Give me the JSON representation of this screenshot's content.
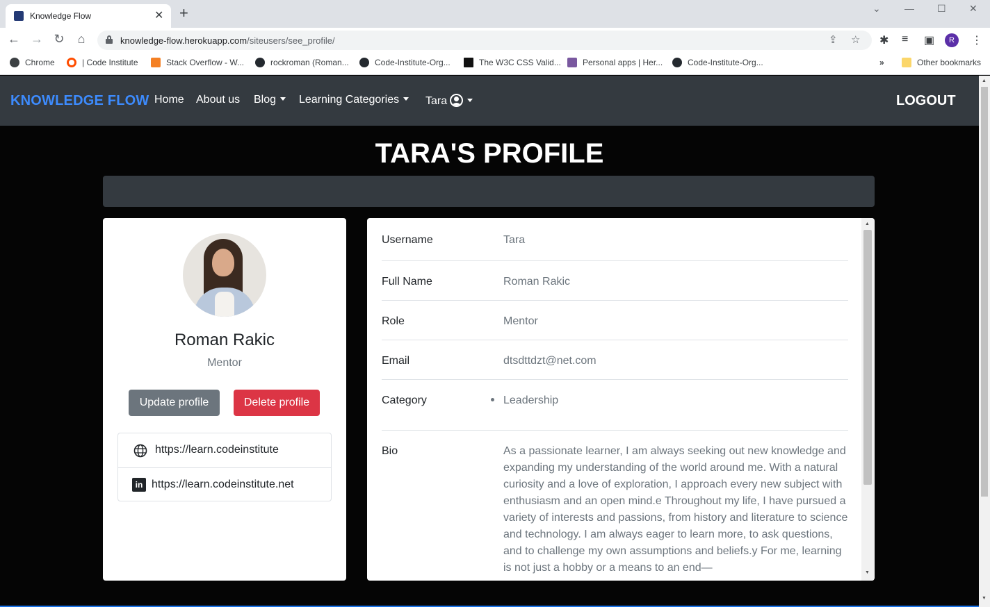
{
  "browser": {
    "tab_title": "Knowledge Flow",
    "url_host": "knowledge-flow.herokuapp.com",
    "url_path": "/siteusers/see_profile/",
    "profile_initial": "R",
    "bookmarks": [
      {
        "label": "Chrome",
        "color": "#3c4043"
      },
      {
        "label": "| Code Institute",
        "color": "#ff4d00"
      },
      {
        "label": "Stack Overflow - W...",
        "color": "#f48024"
      },
      {
        "label": "rockroman (Roman...",
        "color": "#24292f"
      },
      {
        "label": "Code-Institute-Org...",
        "color": "#24292f"
      },
      {
        "label": "The W3C CSS Valid...",
        "color": "#111111"
      },
      {
        "label": "Personal apps | Her...",
        "color": "#79589f"
      },
      {
        "label": "Code-Institute-Org...",
        "color": "#24292f"
      }
    ],
    "more_bookmarks": "»",
    "other_bookmarks": "Other bookmarks"
  },
  "navbar": {
    "brand": "KNOWLEDGE FLOW",
    "links": {
      "home": "Home",
      "about": "About us",
      "blog": "Blog",
      "categories": "Learning Categories",
      "user": "Tara"
    },
    "logout": "LOGOUT"
  },
  "page": {
    "title": "TARA'S PROFILE"
  },
  "profile_card": {
    "name": "Roman Rakic",
    "role": "Mentor",
    "update_label": "Update profile",
    "delete_label": "Delete profile",
    "website": "https://learn.codeinstitute",
    "linkedin": "https://learn.codeinstitute.net"
  },
  "details": {
    "username": {
      "label": "Username",
      "value": "Tara"
    },
    "full_name": {
      "label": "Full Name",
      "value": "Roman Rakic"
    },
    "role": {
      "label": "Role",
      "value": "Mentor"
    },
    "email": {
      "label": "Email",
      "value": "dtsdttdzt@net.com"
    },
    "category": {
      "label": "Category",
      "items": [
        "Leadership"
      ]
    },
    "bio": {
      "label": "Bio",
      "value": "As a passionate learner, I am always seeking out new knowledge and expanding my understanding of the world around me. With a natural curiosity and a love of exploration, I approach every new subject with enthusiasm and an open mind.e Throughout my life, I have pursued a variety of interests and passions, from history and literature to science and technology. I am always eager to learn more, to ask questions, and to challenge my own assumptions and beliefs.y For me, learning is not just a hobby or a means to an end—"
    }
  },
  "colors": {
    "brand": "#3d8bfd",
    "navbar": "#343a40",
    "update_button": "#6c757d",
    "delete_button": "#dc3545"
  }
}
